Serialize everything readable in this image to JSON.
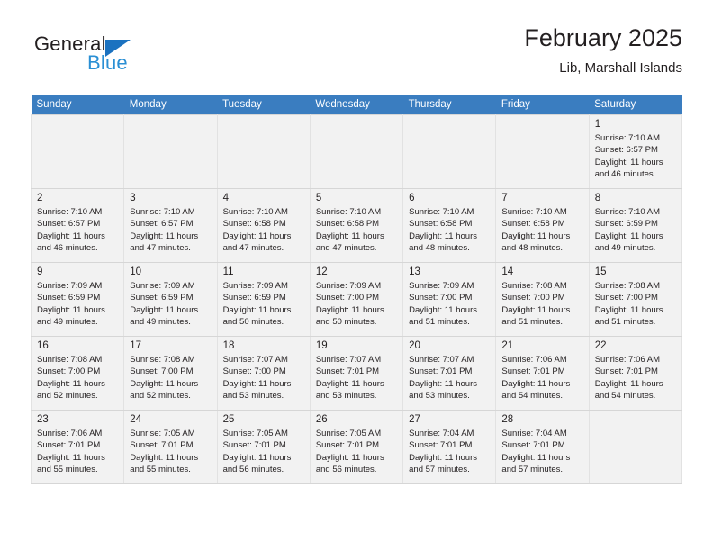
{
  "logo": {
    "text_top": "General",
    "text_bottom": "Blue",
    "icon": "triangle-logo-icon",
    "color_blue": "#2a8fd4",
    "color_triangle": "#1b72c0"
  },
  "header": {
    "title": "February 2025",
    "subtitle": "Lib, Marshall Islands"
  },
  "colors": {
    "header_row_bg": "#3a7dc0",
    "header_row_text": "#ffffff",
    "shaded_row_bg": "#f2f2f2",
    "text": "#231f20",
    "grid_line": "#e2e2e2"
  },
  "weekdays": [
    "Sunday",
    "Monday",
    "Tuesday",
    "Wednesday",
    "Thursday",
    "Friday",
    "Saturday"
  ],
  "weeks": [
    {
      "shaded": true,
      "days": [
        {
          "num": "",
          "lines": ""
        },
        {
          "num": "",
          "lines": ""
        },
        {
          "num": "",
          "lines": ""
        },
        {
          "num": "",
          "lines": ""
        },
        {
          "num": "",
          "lines": ""
        },
        {
          "num": "",
          "lines": ""
        },
        {
          "num": "1",
          "lines": "Sunrise: 7:10 AM\nSunset: 6:57 PM\nDaylight: 11 hours and 46 minutes."
        }
      ]
    },
    {
      "shaded": true,
      "days": [
        {
          "num": "2",
          "lines": "Sunrise: 7:10 AM\nSunset: 6:57 PM\nDaylight: 11 hours and 46 minutes."
        },
        {
          "num": "3",
          "lines": "Sunrise: 7:10 AM\nSunset: 6:57 PM\nDaylight: 11 hours and 47 minutes."
        },
        {
          "num": "4",
          "lines": "Sunrise: 7:10 AM\nSunset: 6:58 PM\nDaylight: 11 hours and 47 minutes."
        },
        {
          "num": "5",
          "lines": "Sunrise: 7:10 AM\nSunset: 6:58 PM\nDaylight: 11 hours and 47 minutes."
        },
        {
          "num": "6",
          "lines": "Sunrise: 7:10 AM\nSunset: 6:58 PM\nDaylight: 11 hours and 48 minutes."
        },
        {
          "num": "7",
          "lines": "Sunrise: 7:10 AM\nSunset: 6:58 PM\nDaylight: 11 hours and 48 minutes."
        },
        {
          "num": "8",
          "lines": "Sunrise: 7:10 AM\nSunset: 6:59 PM\nDaylight: 11 hours and 49 minutes."
        }
      ]
    },
    {
      "shaded": true,
      "days": [
        {
          "num": "9",
          "lines": "Sunrise: 7:09 AM\nSunset: 6:59 PM\nDaylight: 11 hours and 49 minutes."
        },
        {
          "num": "10",
          "lines": "Sunrise: 7:09 AM\nSunset: 6:59 PM\nDaylight: 11 hours and 49 minutes."
        },
        {
          "num": "11",
          "lines": "Sunrise: 7:09 AM\nSunset: 6:59 PM\nDaylight: 11 hours and 50 minutes."
        },
        {
          "num": "12",
          "lines": "Sunrise: 7:09 AM\nSunset: 7:00 PM\nDaylight: 11 hours and 50 minutes."
        },
        {
          "num": "13",
          "lines": "Sunrise: 7:09 AM\nSunset: 7:00 PM\nDaylight: 11 hours and 51 minutes."
        },
        {
          "num": "14",
          "lines": "Sunrise: 7:08 AM\nSunset: 7:00 PM\nDaylight: 11 hours and 51 minutes."
        },
        {
          "num": "15",
          "lines": "Sunrise: 7:08 AM\nSunset: 7:00 PM\nDaylight: 11 hours and 51 minutes."
        }
      ]
    },
    {
      "shaded": true,
      "days": [
        {
          "num": "16",
          "lines": "Sunrise: 7:08 AM\nSunset: 7:00 PM\nDaylight: 11 hours and 52 minutes."
        },
        {
          "num": "17",
          "lines": "Sunrise: 7:08 AM\nSunset: 7:00 PM\nDaylight: 11 hours and 52 minutes."
        },
        {
          "num": "18",
          "lines": "Sunrise: 7:07 AM\nSunset: 7:00 PM\nDaylight: 11 hours and 53 minutes."
        },
        {
          "num": "19",
          "lines": "Sunrise: 7:07 AM\nSunset: 7:01 PM\nDaylight: 11 hours and 53 minutes."
        },
        {
          "num": "20",
          "lines": "Sunrise: 7:07 AM\nSunset: 7:01 PM\nDaylight: 11 hours and 53 minutes."
        },
        {
          "num": "21",
          "lines": "Sunrise: 7:06 AM\nSunset: 7:01 PM\nDaylight: 11 hours and 54 minutes."
        },
        {
          "num": "22",
          "lines": "Sunrise: 7:06 AM\nSunset: 7:01 PM\nDaylight: 11 hours and 54 minutes."
        }
      ]
    },
    {
      "shaded": true,
      "days": [
        {
          "num": "23",
          "lines": "Sunrise: 7:06 AM\nSunset: 7:01 PM\nDaylight: 11 hours and 55 minutes."
        },
        {
          "num": "24",
          "lines": "Sunrise: 7:05 AM\nSunset: 7:01 PM\nDaylight: 11 hours and 55 minutes."
        },
        {
          "num": "25",
          "lines": "Sunrise: 7:05 AM\nSunset: 7:01 PM\nDaylight: 11 hours and 56 minutes."
        },
        {
          "num": "26",
          "lines": "Sunrise: 7:05 AM\nSunset: 7:01 PM\nDaylight: 11 hours and 56 minutes."
        },
        {
          "num": "27",
          "lines": "Sunrise: 7:04 AM\nSunset: 7:01 PM\nDaylight: 11 hours and 57 minutes."
        },
        {
          "num": "28",
          "lines": "Sunrise: 7:04 AM\nSunset: 7:01 PM\nDaylight: 11 hours and 57 minutes."
        },
        {
          "num": "",
          "lines": ""
        }
      ]
    }
  ]
}
